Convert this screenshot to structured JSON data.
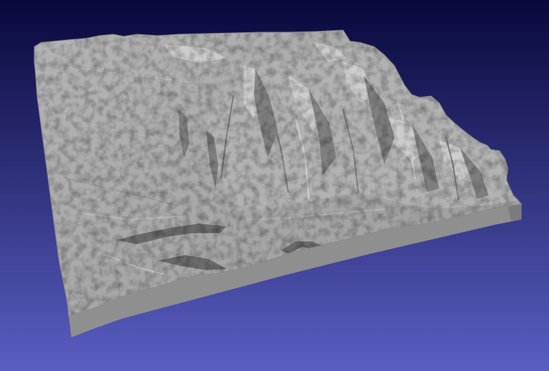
{
  "viewer": {
    "background_top_color": "#08083a",
    "background_bottom_color": "#5a5ec2",
    "model": {
      "description_icon": "terrain-mesh-icon",
      "surface_color": "#a9a9a9",
      "side_front_color": "#8f8f8f",
      "side_right_color": "#7b7b7b",
      "shadow_color": "#5f5f5f",
      "highlight_color": "#d6d6d6"
    }
  }
}
